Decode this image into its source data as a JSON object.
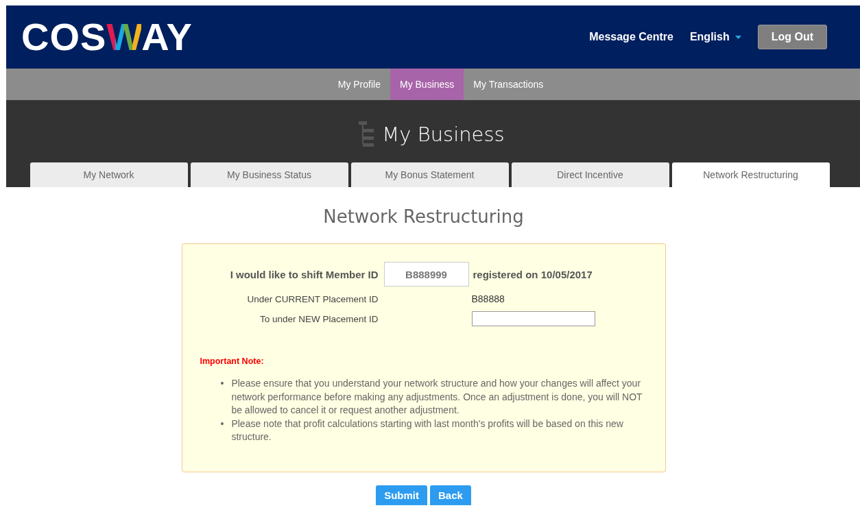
{
  "header": {
    "logo": "COSWAY",
    "links": [
      "Message Centre"
    ],
    "language": "English",
    "logout": "Log Out"
  },
  "nav": [
    {
      "label": "My Profile",
      "selected": false
    },
    {
      "label": "My Business",
      "selected": true
    },
    {
      "label": "My Transactions",
      "selected": false
    }
  ],
  "section_title": "My Business",
  "tabs": [
    {
      "label": "My Network",
      "selected": false
    },
    {
      "label": "My Business Status",
      "selected": false
    },
    {
      "label": "My Bonus Statement",
      "selected": false
    },
    {
      "label": "Direct Incentive",
      "selected": false
    },
    {
      "label": "Network Restructuring",
      "selected": true
    }
  ],
  "page_title": "Network Restructuring",
  "form": {
    "shift_label": "I would like to shift Member ID",
    "member_id": "B888999",
    "registered": "registered on 10/05/2017",
    "current_label": "Under CURRENT Placement ID",
    "current_id": "B88888",
    "new_label": "To under NEW Placement ID"
  },
  "note": {
    "title": "Important Note:",
    "items": [
      {
        "bullet": "•",
        "text": "Please ensure that you understand your network structure and how your changes will affect your network performance before making any adjustments. Once an adjustment is done, you will NOT be allowed to cancel it or request another adjustment."
      },
      {
        "bullet": "•",
        "text": "Please note that profit calculations starting with last month's profits will be based on this new structure."
      }
    ]
  },
  "buttons": [
    "Submit",
    "Back"
  ]
}
